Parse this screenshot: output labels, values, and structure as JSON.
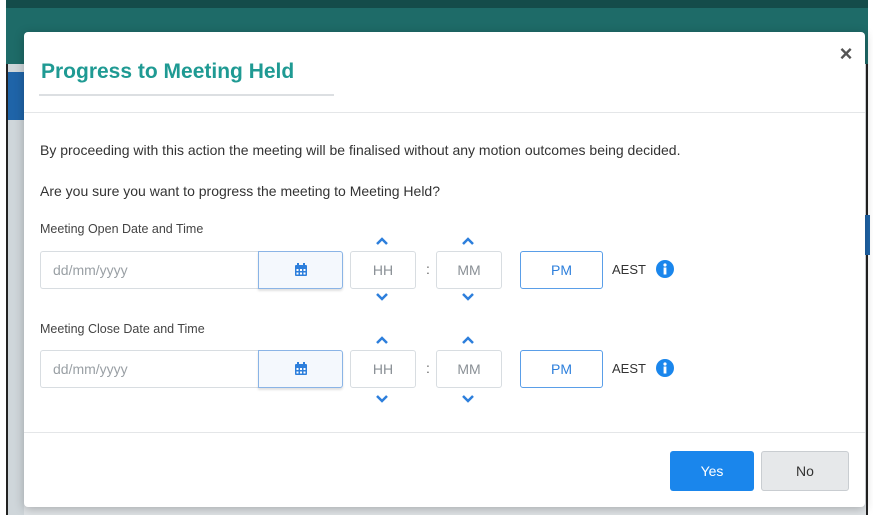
{
  "modal": {
    "title": "Progress to Meeting Held",
    "close_symbol": "×",
    "message_1": "By proceeding with this action the meeting will be finalised without any motion outcomes being decided.",
    "message_2": "Are you sure you want to progress the meeting to Meeting Held?"
  },
  "open_datetime": {
    "label": "Meeting Open Date and Time",
    "date_placeholder": "dd/mm/yyyy",
    "hour": "HH",
    "minute": "MM",
    "separator": ":",
    "ampm": "PM",
    "timezone": "AEST"
  },
  "close_datetime": {
    "label": "Meeting Close Date and Time",
    "date_placeholder": "dd/mm/yyyy",
    "hour": "HH",
    "minute": "MM",
    "separator": ":",
    "ampm": "PM",
    "timezone": "AEST"
  },
  "buttons": {
    "yes": "Yes",
    "no": "No"
  },
  "icons": {
    "calendar": "calendar-icon",
    "info": "info-circle-icon",
    "chevron_up": "chevron-up-icon",
    "chevron_down": "chevron-down-icon",
    "close": "close-icon"
  },
  "colors": {
    "title": "#1f9a93",
    "accent": "#1a86ec",
    "header": "#1e6b68"
  }
}
